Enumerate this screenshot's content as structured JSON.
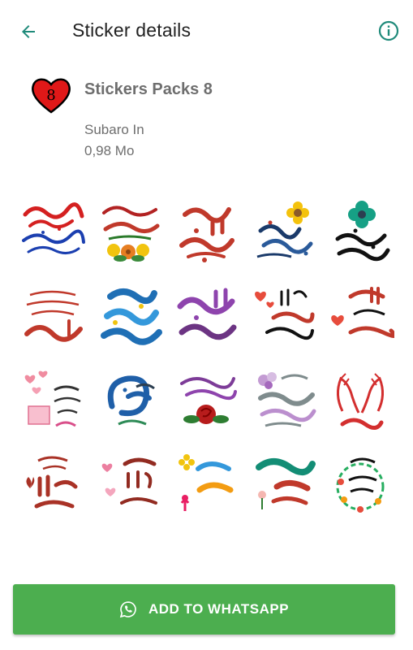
{
  "toolbar": {
    "title": "Sticker details",
    "back_icon": "arrow-back-icon",
    "info_icon": "info-icon",
    "accent": "#1f8a7a"
  },
  "pack": {
    "icon": "heart-8-icon",
    "icon_number": "8",
    "name": "Stickers Packs 8",
    "author": "Subaro In",
    "size": "0,98 Mo"
  },
  "stickers": [
    {
      "icon": "sticker-jumua-red-blue"
    },
    {
      "icon": "sticker-tayyib-flowers"
    },
    {
      "icon": "sticker-jumua-mubaraka-red"
    },
    {
      "icon": "sticker-jumua-yellow-flower"
    },
    {
      "icon": "sticker-jumua-teal-flower"
    },
    {
      "icon": "sticker-duaa-red"
    },
    {
      "icon": "sticker-saat-istijaba-blue"
    },
    {
      "icon": "sticker-nasalukum-purple"
    },
    {
      "icon": "sticker-allah-hearts"
    },
    {
      "icon": "sticker-asaad-heart"
    },
    {
      "icon": "sticker-sabahkum-hearts"
    },
    {
      "icon": "sticker-sabah-blue"
    },
    {
      "icon": "sticker-salla-rose"
    },
    {
      "icon": "sticker-sabah-khairat-lilac"
    },
    {
      "icon": "sticker-amin-hands"
    },
    {
      "icon": "sticker-sabahkum-butterfly"
    },
    {
      "icon": "sticker-asaad-pink-hearts"
    },
    {
      "icon": "sticker-sabah-noor-yellow"
    },
    {
      "icon": "sticker-sabah-khair-teal"
    },
    {
      "icon": "sticker-tawakkul-wreath"
    }
  ],
  "add_button": {
    "label": "ADD TO WHATSAPP",
    "icon": "whatsapp-icon",
    "color": "#4cae4f"
  }
}
